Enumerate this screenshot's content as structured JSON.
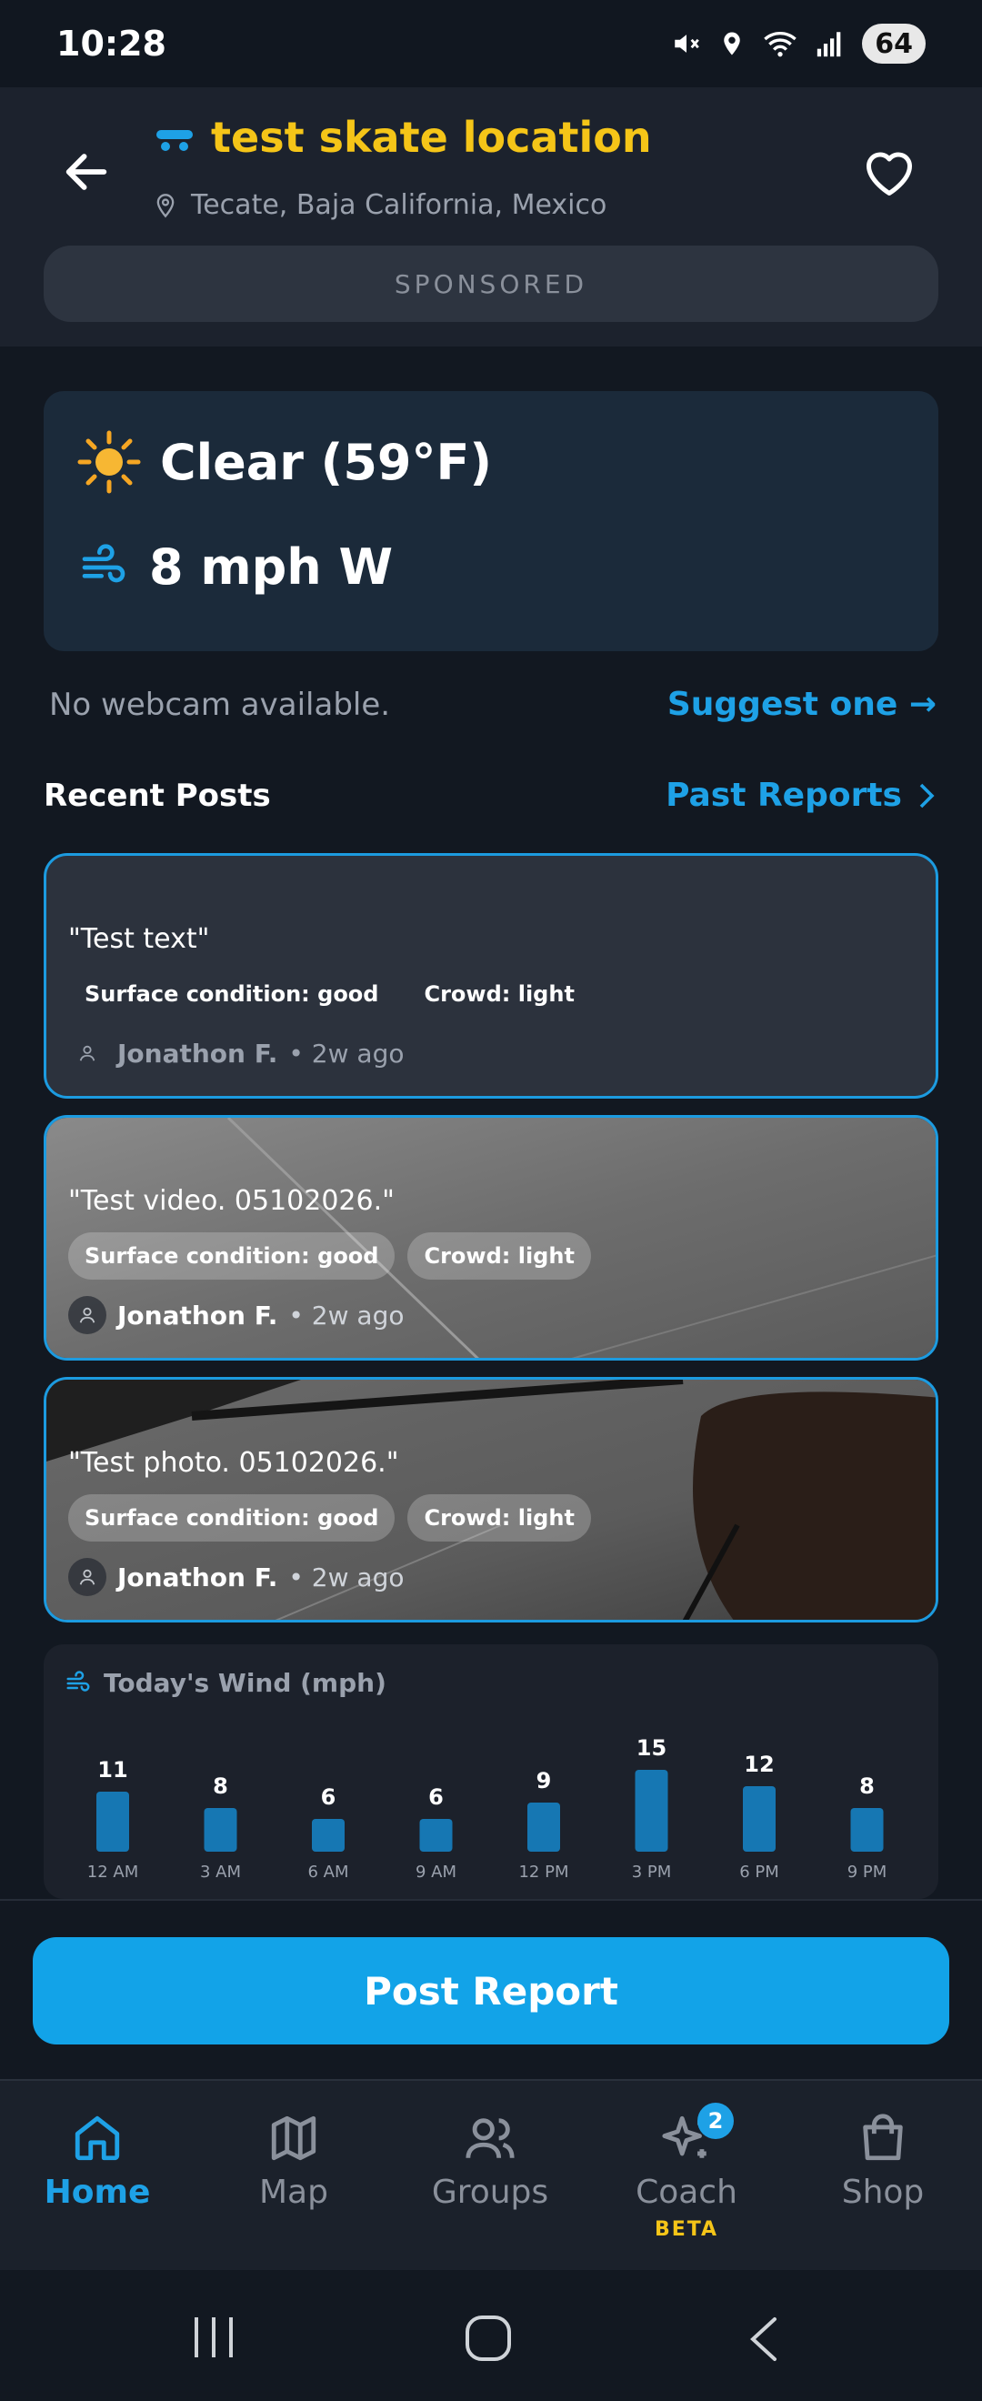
{
  "status_bar": {
    "time": "10:28",
    "battery": "64"
  },
  "header": {
    "title": "test skate location",
    "location": "Tecate, Baja California, Mexico",
    "sponsored_label": "SPONSORED"
  },
  "weather": {
    "condition": "Clear  (59°F)",
    "wind": "8 mph W"
  },
  "webcam": {
    "status": "No webcam available.",
    "suggest_link": "Suggest one →"
  },
  "recent_posts": {
    "title": "Recent Posts",
    "past_reports_link": "Past Reports",
    "posts": [
      {
        "quote": "\"Test text\"",
        "surface": "Surface condition: good",
        "crowd": "Crowd: light",
        "author": "Jonathon F.",
        "time": "• 2w ago"
      },
      {
        "quote": "\"Test video. 05102026.\"",
        "surface": "Surface condition: good",
        "crowd": "Crowd: light",
        "author": "Jonathon F.",
        "time": "• 2w ago"
      },
      {
        "quote": "\"Test photo. 05102026.\"",
        "surface": "Surface condition: good",
        "crowd": "Crowd: light",
        "author": "Jonathon F.",
        "time": "• 2w ago"
      }
    ]
  },
  "chart_data": {
    "type": "bar",
    "title": "Today's Wind (mph)",
    "categories": [
      "12 AM",
      "3 AM",
      "6 AM",
      "9 AM",
      "12 PM",
      "3 PM",
      "6 PM",
      "9 PM"
    ],
    "values": [
      11,
      8,
      6,
      6,
      9,
      15,
      12,
      8
    ],
    "color": "#1677b3"
  },
  "actions": {
    "post_report": "Post Report"
  },
  "bottom_nav": {
    "items": [
      {
        "label": "Home",
        "icon": "home-icon"
      },
      {
        "label": "Map",
        "icon": "map-icon"
      },
      {
        "label": "Groups",
        "icon": "groups-icon"
      },
      {
        "label": "Coach",
        "icon": "sparkle-icon",
        "badge": "2",
        "sublabel": "BETA"
      },
      {
        "label": "Shop",
        "icon": "shopping-bag-icon"
      }
    ]
  },
  "colors": {
    "accent": "#1ea1e6",
    "title_yellow": "#f5c518",
    "background": "#121821"
  }
}
